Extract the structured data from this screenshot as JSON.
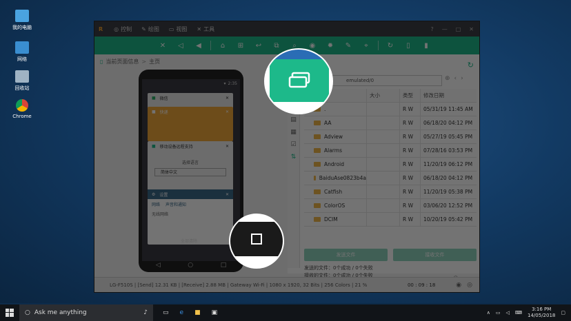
{
  "desktop": {
    "icons": [
      {
        "label": "我的电脑",
        "icon": "computer-icon"
      },
      {
        "label": "网络",
        "icon": "network-icon"
      },
      {
        "label": "回收站",
        "icon": "recycle-bin-icon"
      },
      {
        "label": "Chrome",
        "icon": "chrome-icon"
      }
    ]
  },
  "app": {
    "logo": "R",
    "menu": [
      {
        "label": "控制",
        "icon": "control-icon"
      },
      {
        "label": "绘图",
        "icon": "pen-icon"
      },
      {
        "label": "视图",
        "icon": "monitor-icon"
      },
      {
        "label": "工具",
        "icon": "tools-icon"
      }
    ],
    "window_buttons": [
      "?",
      "—",
      "□",
      "✕"
    ],
    "toolbar": [
      "mute-icon",
      "volume-down-icon",
      "volume-up-icon",
      "home-icon",
      "apps-icon",
      "back-icon",
      "recent-apps-icon",
      "search-icon",
      "camera-icon",
      "settings-icon",
      "brush-icon",
      "pin-icon",
      "rotate-icon",
      "phone-icon",
      "phone-alt-icon"
    ],
    "breadcrumb": {
      "root": "当前页面信息",
      "separator": ">",
      "current": "主页"
    },
    "phone": {
      "status_time": "2:35",
      "cards": [
        {
          "title": "微信",
          "color": "#e8e8e8"
        },
        {
          "title": "快递",
          "color": "#f2a93b"
        },
        {
          "title": "移动设备远程支持",
          "color": "#f0f0f0",
          "sub": "选择语言",
          "option": "简体中文"
        },
        {
          "title": "设置",
          "color": "#3b6a8a",
          "sub1": "网络",
          "sub2": "声音和通知",
          "sub3": "无线网络"
        }
      ],
      "clear_all": "全部清除",
      "nav": [
        "◁",
        "○",
        "□"
      ]
    },
    "filepanel": {
      "path": "emulated/0",
      "columns": [
        "名称",
        "大小",
        "类型",
        "修改日期"
      ],
      "rows": [
        {
          "name": ".",
          "size": "",
          "type": "R W",
          "date": "05/31/19 11:45 AM"
        },
        {
          "name": "AA",
          "size": "",
          "type": "R W",
          "date": "06/18/20 04:12 PM"
        },
        {
          "name": "Adview",
          "size": "",
          "type": "R W",
          "date": "05/27/19 05:45 PM"
        },
        {
          "name": "Alarms",
          "size": "",
          "type": "R W",
          "date": "07/28/16 03:53 PM"
        },
        {
          "name": "Android",
          "size": "",
          "type": "R W",
          "date": "11/20/19 06:12 PM"
        },
        {
          "name": "BaiduAse0823b4a",
          "size": "",
          "type": "R W",
          "date": "06/18/20 04:12 PM"
        },
        {
          "name": "Catfish",
          "size": "",
          "type": "R W",
          "date": "11/20/19 05:38 PM"
        },
        {
          "name": "ColorOS",
          "size": "",
          "type": "R W",
          "date": "03/06/20 12:52 PM"
        },
        {
          "name": "DCIM",
          "size": "",
          "type": "R W",
          "date": "10/20/19 05:42 PM"
        }
      ],
      "send_button": "发送文件",
      "receive_button": "接收文件",
      "sent_line": "发送的文件：0个成功 / 0个失败",
      "received_line": "接收的文件：0个成功 / 0个失败"
    },
    "status": {
      "info": "LG-F510S | [Send] 12.31 KB | [Receive] 2.88 MB | Gateway Wi-Fi | 1080 x 1920, 32 Bits | 256 Colors | 21 %",
      "timer": "00 : 09 : 18"
    }
  },
  "taskbar": {
    "search_text": "Ask me anything",
    "clock_time": "3:16 PM",
    "clock_date": "14/05/2018"
  },
  "colors": {
    "accent": "#1db98a",
    "desktop": "#123a63",
    "taskbar": "#111418"
  }
}
